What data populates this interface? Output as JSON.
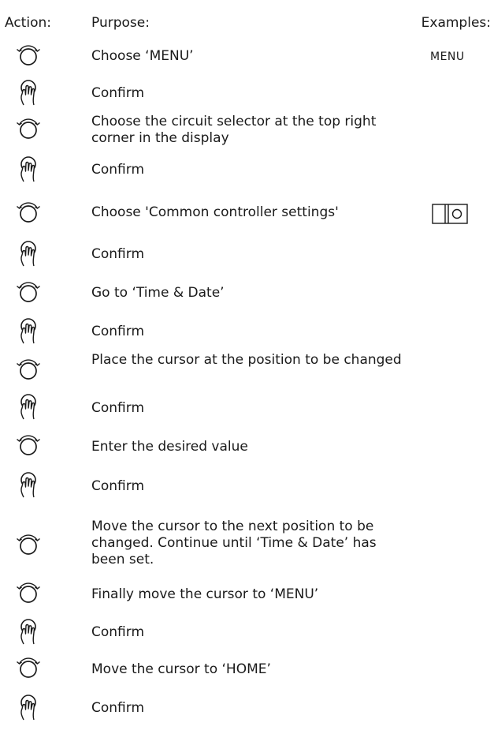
{
  "headers": {
    "action": "Action:",
    "purpose": "Purpose:",
    "examples": "Examples:"
  },
  "steps": [
    {
      "action_icon": "turn-dial-icon",
      "purpose": "Choose ‘MENU’",
      "example": "MENU"
    },
    {
      "action_icon": "push-dial-icon",
      "purpose": "Confirm"
    },
    {
      "action_icon": "turn-dial-icon",
      "purpose": "Choose the circuit selector at the top right corner in the display"
    },
    {
      "action_icon": "push-dial-icon",
      "purpose": "Confirm"
    },
    {
      "action_icon": "turn-dial-icon",
      "purpose": "Choose 'Common controller settings'",
      "example_icon": "circuit-selector-icon"
    },
    {
      "action_icon": "push-dial-icon",
      "purpose": "Confirm"
    },
    {
      "action_icon": "turn-dial-icon",
      "purpose": "Go to ‘Time & Date’"
    },
    {
      "action_icon": "push-dial-icon",
      "purpose": "Confirm"
    },
    {
      "action_icon": "turn-dial-icon",
      "purpose": "Place the cursor at the position to be changed"
    },
    {
      "action_icon": "push-dial-icon",
      "purpose": "Confirm"
    },
    {
      "action_icon": "turn-dial-icon",
      "purpose": "Enter the desired value"
    },
    {
      "action_icon": "push-dial-icon",
      "purpose": "Confirm"
    },
    {
      "action_icon": "turn-dial-icon",
      "purpose": "Move the cursor to the next position to be changed. Continue until ‘Time & Date’ has been set."
    },
    {
      "action_icon": "turn-dial-icon",
      "purpose": "Finally move the cursor to ‘MENU’"
    },
    {
      "action_icon": "push-dial-icon",
      "purpose": "Confirm"
    },
    {
      "action_icon": "turn-dial-icon",
      "purpose": "Move the cursor to ‘HOME’"
    },
    {
      "action_icon": "push-dial-icon",
      "purpose": "Confirm"
    }
  ]
}
